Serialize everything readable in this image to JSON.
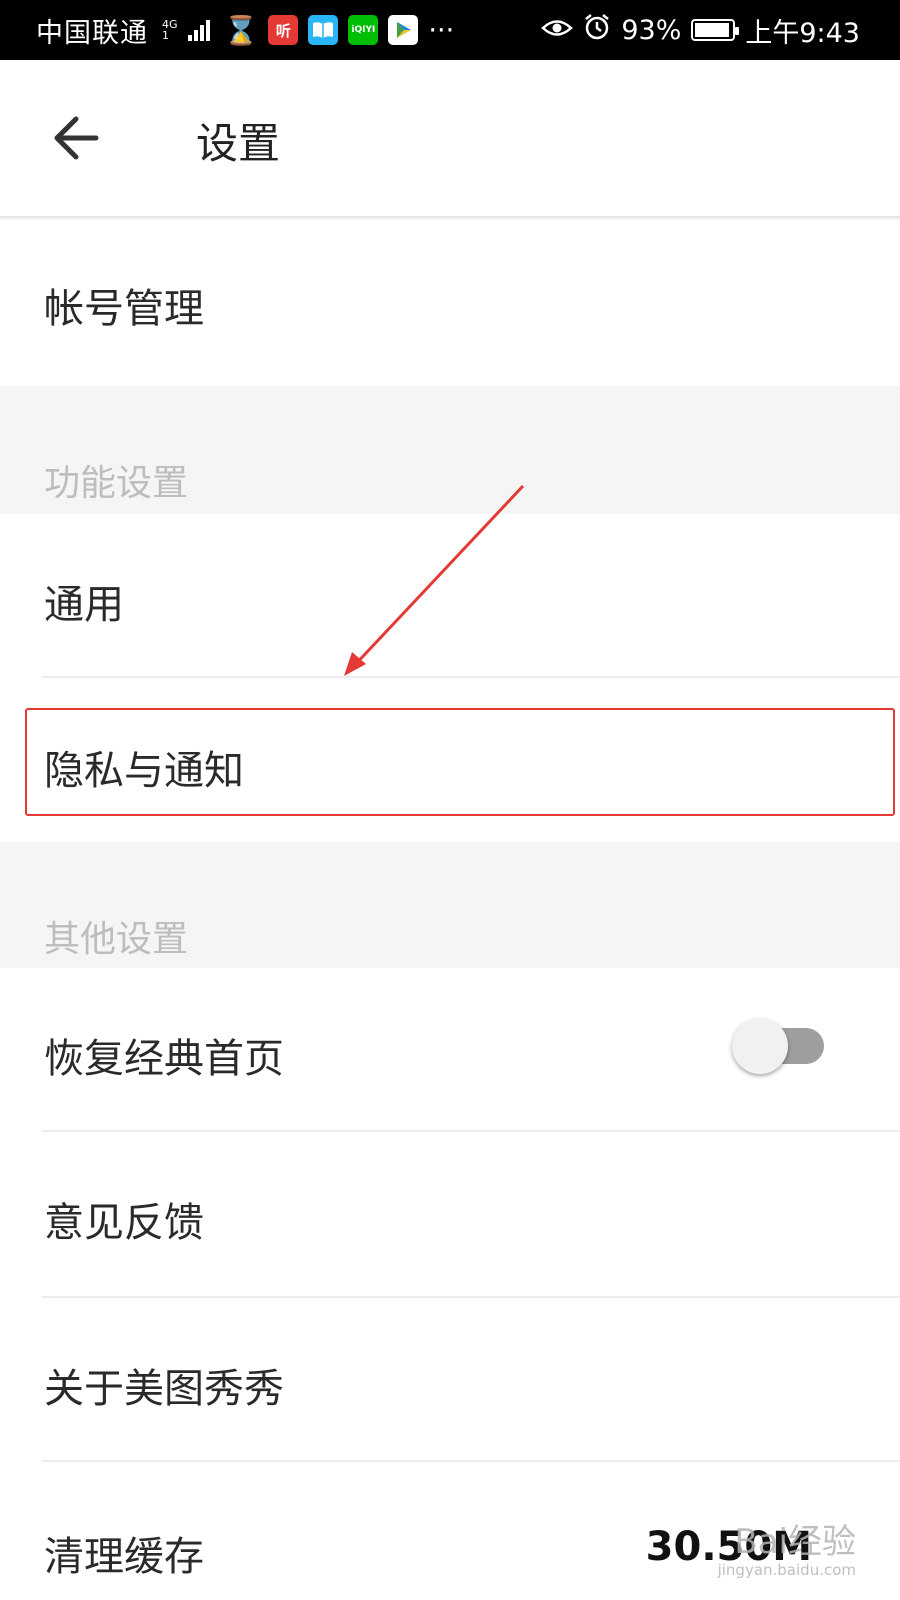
{
  "status_bar": {
    "carrier": "中国联通",
    "network": "4G",
    "net_detail": "1",
    "apps": [
      {
        "name": "hourglass-icon",
        "label": "⌛",
        "color": "#000000"
      },
      {
        "name": "ting-app-icon",
        "label": "听",
        "color": "#e53935"
      },
      {
        "name": "book-app-icon",
        "label": "📖",
        "color": "#29b6f6"
      },
      {
        "name": "iqiyi-app-icon",
        "label": "iQIYI",
        "color": "#00be06"
      },
      {
        "name": "video-app-icon",
        "label": "▶",
        "color": "#fbc02d"
      }
    ],
    "more": "···",
    "battery": "93%",
    "battery_level": 0.93,
    "time": "上午9:43"
  },
  "header": {
    "back_icon": "back-arrow-icon",
    "title": "设置"
  },
  "items": {
    "account": "帐号管理",
    "section_features": "功能设置",
    "general": "通用",
    "privacy": "隐私与通知",
    "section_other": "其他设置",
    "classic_home": "恢复经典首页",
    "classic_home_enabled": false,
    "feedback": "意见反馈",
    "about": "关于美图秀秀",
    "clear_cache": "清理缓存",
    "cache_size": "30.50M"
  },
  "annotation": {
    "color": "#e53935"
  },
  "watermark": {
    "text": "Bai经验",
    "sub": "jingyan.baidu.com"
  }
}
